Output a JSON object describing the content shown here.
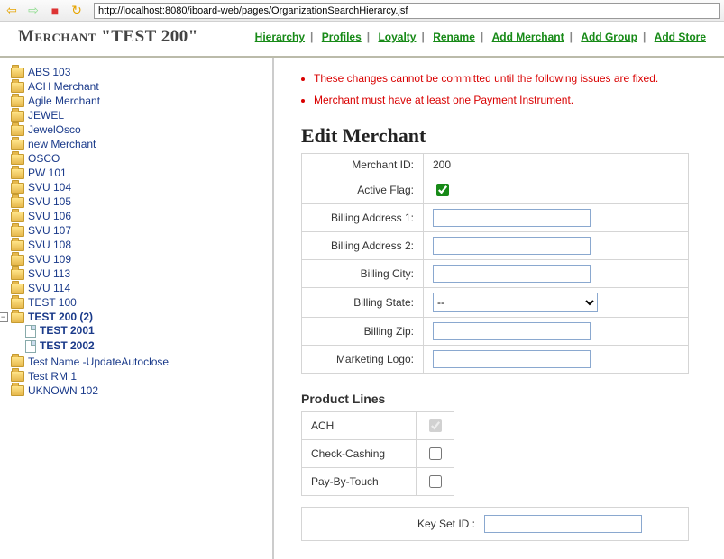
{
  "toolbar": {
    "url": "http://localhost:8080/iboard-web/pages/OrganizationSearchHierarcy.jsf"
  },
  "header": {
    "title": "Merchant \"TEST 200\"",
    "links": [
      "Hierarchy",
      "Profiles",
      "Loyalty",
      "Rename",
      "Add Merchant",
      "Add Group",
      "Add Store"
    ]
  },
  "tree": {
    "items": [
      {
        "label": "ABS 103"
      },
      {
        "label": "ACH Merchant"
      },
      {
        "label": "Agile Merchant"
      },
      {
        "label": "JEWEL"
      },
      {
        "label": "JewelOsco"
      },
      {
        "label": "new Merchant"
      },
      {
        "label": "OSCO"
      },
      {
        "label": "PW 101"
      },
      {
        "label": "SVU 104"
      },
      {
        "label": "SVU 105"
      },
      {
        "label": "SVU 106"
      },
      {
        "label": "SVU 107"
      },
      {
        "label": "SVU 108"
      },
      {
        "label": "SVU 109"
      },
      {
        "label": "SVU 113"
      },
      {
        "label": "SVU 114"
      },
      {
        "label": "TEST 100"
      }
    ],
    "selected": {
      "label": "TEST 200 (2)",
      "children": [
        {
          "label": "TEST 2001"
        },
        {
          "label": "TEST 2002"
        }
      ]
    },
    "items_after": [
      {
        "label": "Test Name -UpdateAutoclose"
      },
      {
        "label": "Test RM 1"
      },
      {
        "label": "UKNOWN 102"
      }
    ]
  },
  "errors": [
    "These changes cannot be committed until the following issues are fixed.",
    "Merchant must have at least one Payment Instrument."
  ],
  "edit": {
    "title": "Edit Merchant",
    "fields": {
      "merchant_id_label": "Merchant ID:",
      "merchant_id_value": "200",
      "active_flag_label": "Active Flag:",
      "active_flag_checked": "true",
      "billing_addr1_label": "Billing Address 1:",
      "billing_addr1_value": "",
      "billing_addr2_label": "Billing Address 2:",
      "billing_addr2_value": "",
      "billing_city_label": "Billing City:",
      "billing_city_value": "",
      "billing_state_label": "Billing State:",
      "billing_state_value": "--",
      "billing_zip_label": "Billing Zip:",
      "billing_zip_value": "",
      "marketing_logo_label": "Marketing Logo:",
      "marketing_logo_value": ""
    }
  },
  "product_lines": {
    "title": "Product Lines",
    "rows": [
      {
        "label": "ACH",
        "checked": "true",
        "disabled": "true"
      },
      {
        "label": "Check-Cashing",
        "checked": "false",
        "disabled": "false"
      },
      {
        "label": "Pay-By-Touch",
        "checked": "false",
        "disabled": "false"
      }
    ]
  },
  "keyset": {
    "label": "Key Set ID :",
    "value": ""
  }
}
